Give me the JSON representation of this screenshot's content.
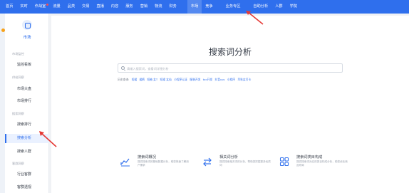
{
  "nav": {
    "items": [
      "首页",
      "实时",
      "作战室",
      "流量",
      "品类",
      "交易",
      "直播",
      "内容",
      "服务",
      "营销",
      "物流",
      "财务",
      "市场",
      "竞争",
      "业务专区",
      "自助分析",
      "人群",
      "学院"
    ],
    "active_index": 12,
    "badge_index": 2
  },
  "sidebar": {
    "title": "市场",
    "groups": [
      {
        "label": "市场监控",
        "items": [
          "监控看板"
        ]
      },
      {
        "label": "供给洞察",
        "items": [
          "市场大盘",
          "市场排行"
        ]
      },
      {
        "label": "搜索洞察",
        "items": [
          "搜索排行",
          "搜索分析",
          "搜索人群"
        ]
      },
      {
        "label": "客群洞察",
        "items": [
          "行业客群",
          "客群透视"
        ]
      }
    ],
    "active_item": "搜索分析"
  },
  "main": {
    "title": "搜索词分析",
    "search_placeholder": "请输入搜索词，查看词详细分析",
    "tags_label": "历史查询:",
    "tags": [
      "短裙",
      "裙裤",
      "短袖 女T",
      "短裙 女仙",
      "小程序认证",
      "服装开发",
      "toc开发",
      "抖音cps",
      "小程序",
      "早秋女打卡"
    ],
    "features": [
      {
        "icon": "trend-chart-icon",
        "title": "搜索词概况",
        "desc": "提供搜索词的基础数据分析，助您快速了解用户需求"
      },
      {
        "icon": "swap-arrows-icon",
        "title": "相关词分析",
        "desc": "提供搜索相关词的分析，帮助您挖掘更多优质词"
      },
      {
        "icon": "grid-apps-icon",
        "title": "搜索词类目构成",
        "desc": "提供搜索词对应的类目构成分析，助您优化商品布局"
      }
    ]
  },
  "colors": {
    "brand": "#2f6fed",
    "annotation_arrow": "#e53935"
  }
}
